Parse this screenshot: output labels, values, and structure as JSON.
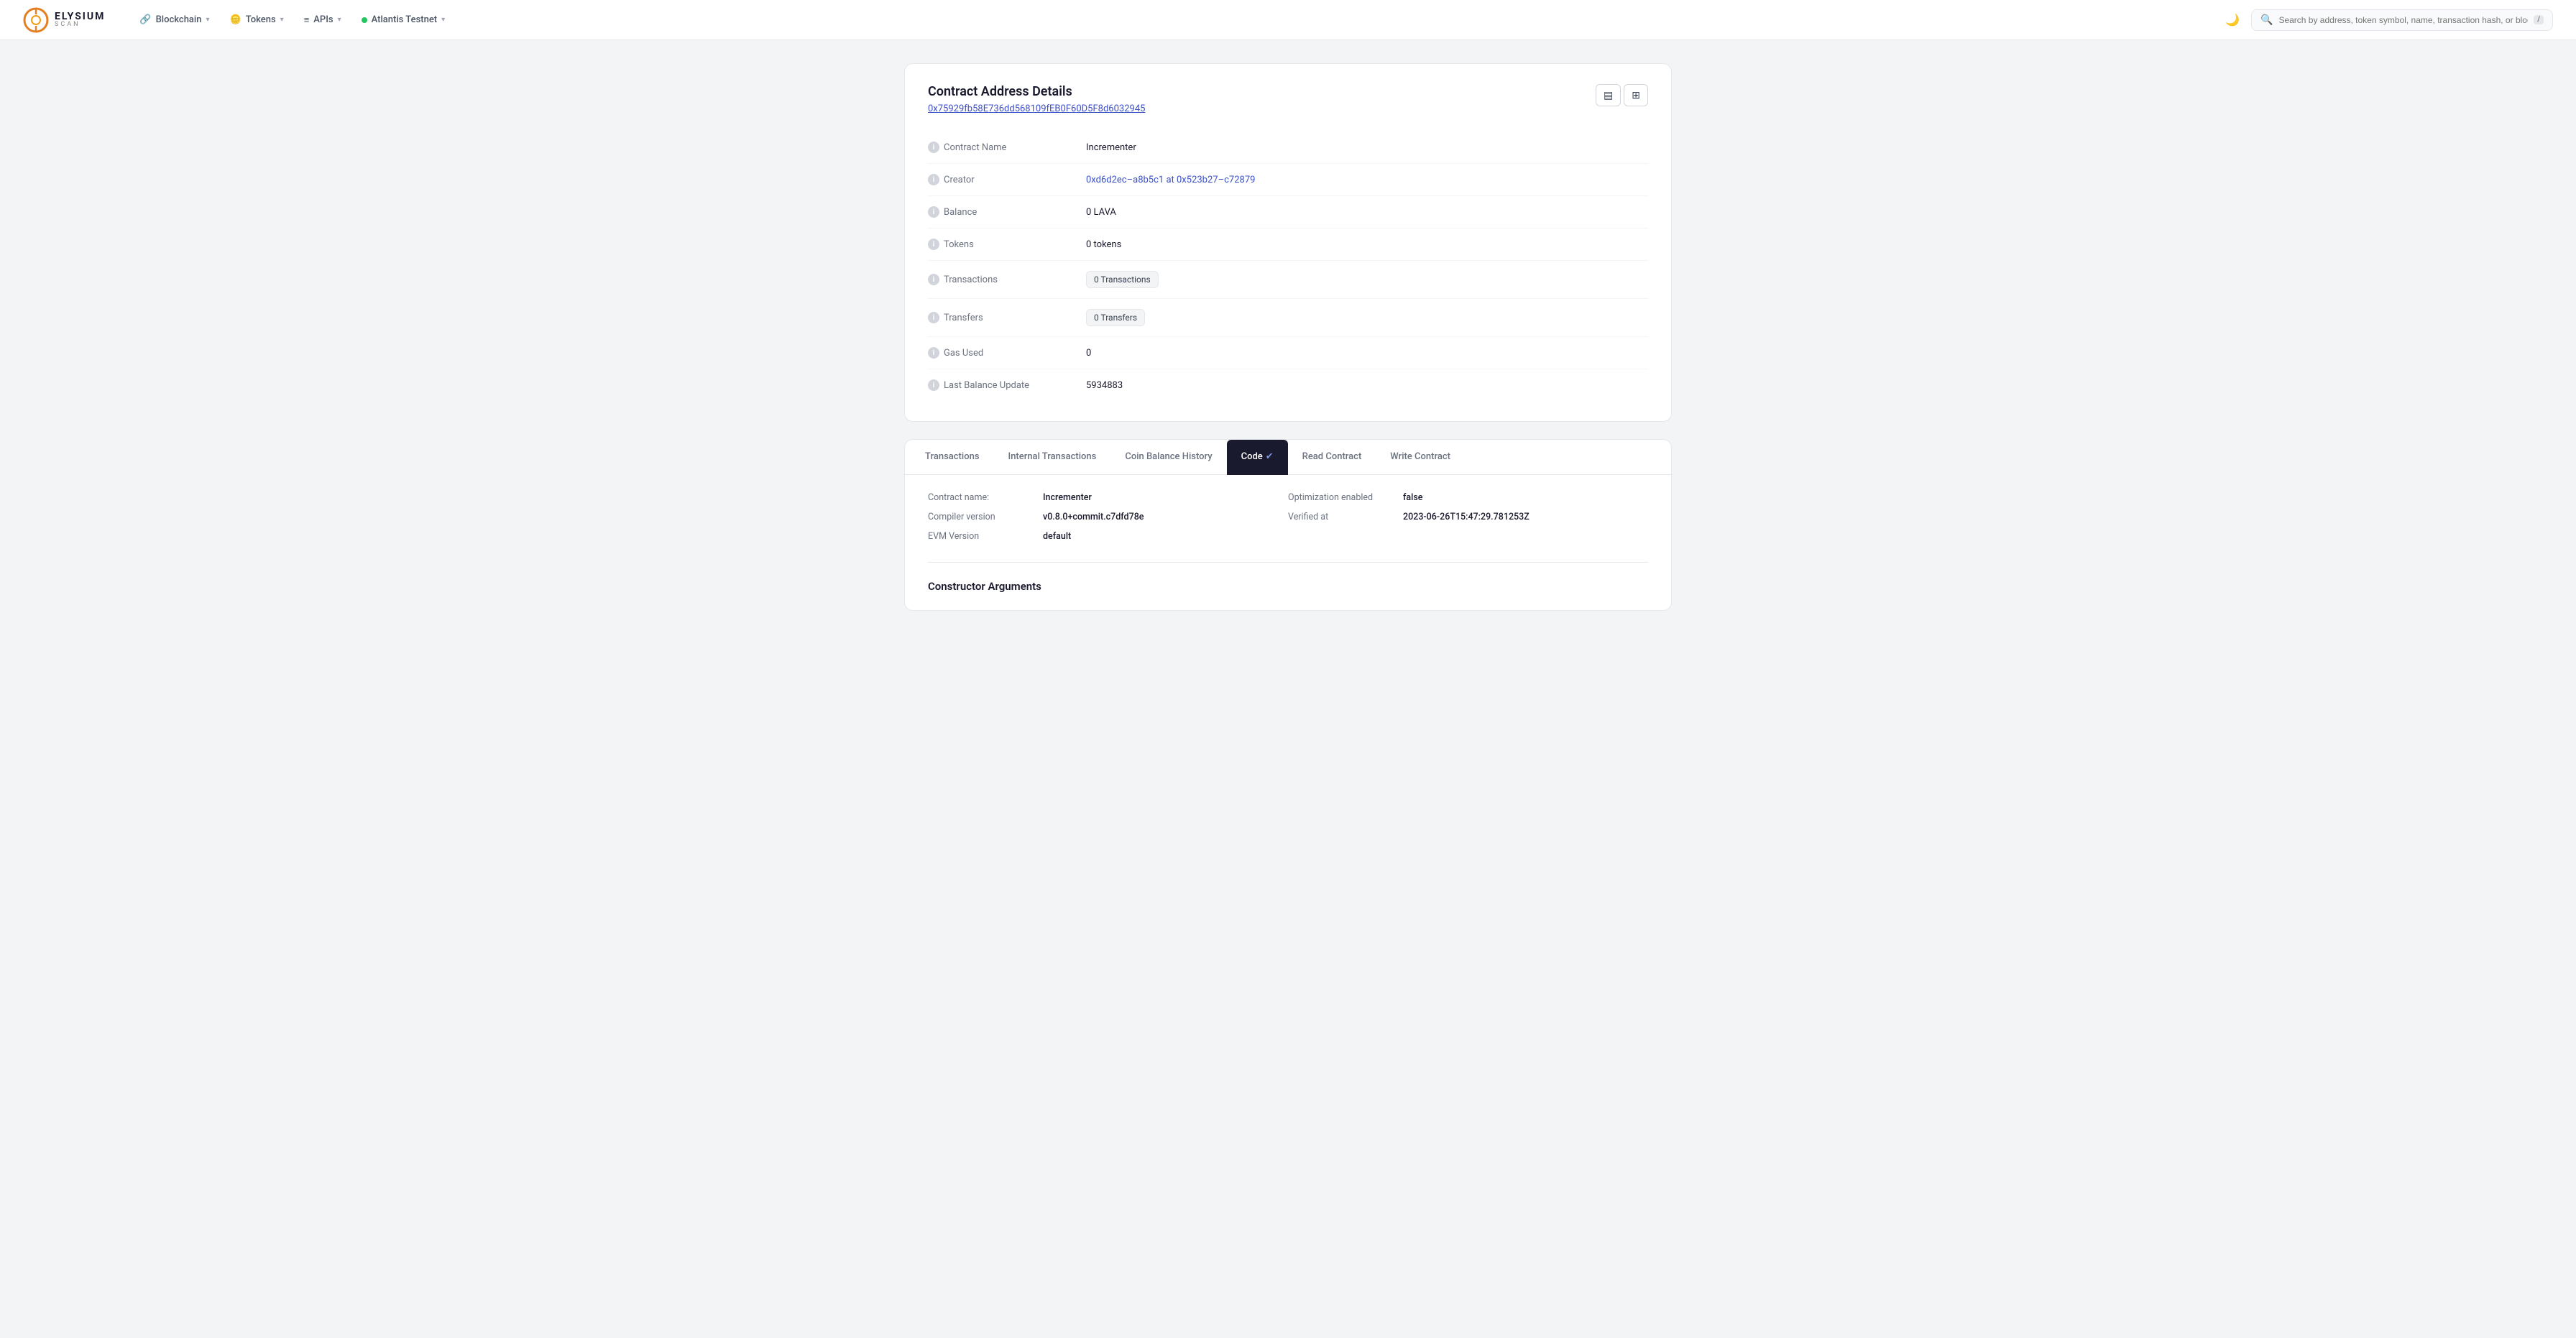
{
  "logo": {
    "name": "ELYSIUM",
    "sub": "SCAN"
  },
  "navbar": {
    "blockchain_label": "Blockchain",
    "tokens_label": "Tokens",
    "apis_label": "APIs",
    "network_label": "Atlantis Testnet",
    "search_placeholder": "Search by address, token symbol, name, transaction hash, or block number",
    "kbd": "/",
    "moon_icon": "🌙"
  },
  "contract": {
    "section_title": "Contract Address Details",
    "address": "0x75929fb58E736dd568109fEB0F60D5F8d6032945",
    "fields": [
      {
        "key": "contract_name",
        "label": "Contract Name",
        "value": "Incrementer"
      },
      {
        "key": "creator",
        "label": "Creator",
        "value": "0xd6d2ec–a8b5c1 at 0x523b27–c72879"
      },
      {
        "key": "balance",
        "label": "Balance",
        "value": "0 LAVA"
      },
      {
        "key": "tokens",
        "label": "Tokens",
        "value": "0 tokens"
      },
      {
        "key": "transactions",
        "label": "Transactions",
        "value": "0 Transactions",
        "badge": true
      },
      {
        "key": "transfers",
        "label": "Transfers",
        "value": "0 Transfers",
        "badge": true
      },
      {
        "key": "gas_used",
        "label": "Gas Used",
        "value": "0"
      },
      {
        "key": "last_balance_update",
        "label": "Last Balance Update",
        "value": "5934883"
      }
    ]
  },
  "tabs": [
    {
      "key": "transactions",
      "label": "Transactions",
      "active": false
    },
    {
      "key": "internal_transactions",
      "label": "Internal Transactions",
      "active": false
    },
    {
      "key": "coin_balance_history",
      "label": "Coin Balance History",
      "active": false
    },
    {
      "key": "code",
      "label": "Code",
      "active": true,
      "verified": true
    },
    {
      "key": "read_contract",
      "label": "Read Contract",
      "active": false
    },
    {
      "key": "write_contract",
      "label": "Write Contract",
      "active": false
    }
  ],
  "code_section": {
    "contract_name_label": "Contract name:",
    "contract_name_value": "Incrementer",
    "compiler_version_label": "Compiler version",
    "compiler_version_value": "v0.8.0+commit.c7dfd78e",
    "evm_version_label": "EVM Version",
    "evm_version_value": "default",
    "optimization_enabled_label": "Optimization enabled",
    "optimization_enabled_value": "false",
    "verified_at_label": "Verified at",
    "verified_at_value": "2023-06-26T15:47:29.781253Z",
    "constructor_args_title": "Constructor Arguments"
  },
  "view_buttons": {
    "list_icon": "▤",
    "grid_icon": "⊞"
  }
}
